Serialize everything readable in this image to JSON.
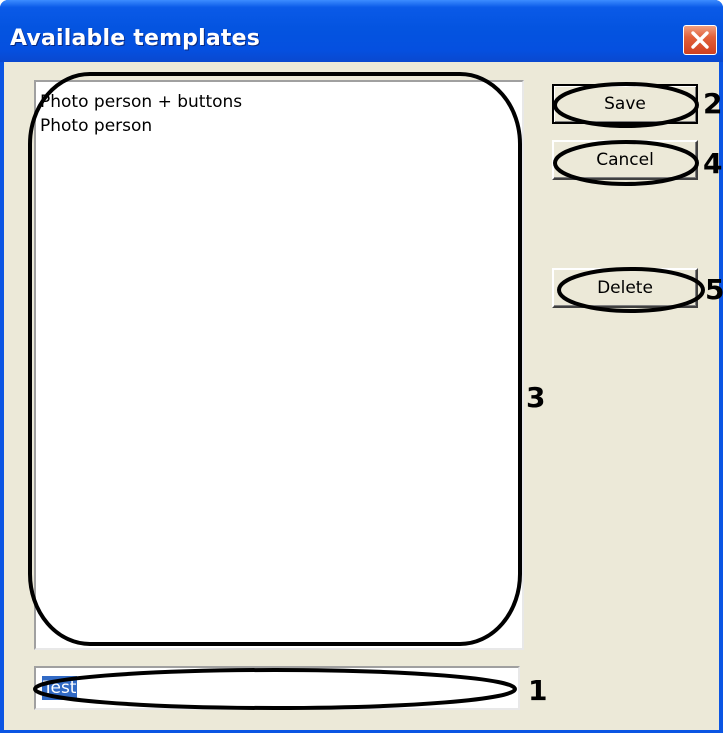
{
  "window": {
    "title": "Available templates"
  },
  "templates_list": {
    "items": [
      "Photo person + buttons",
      "Photo person"
    ]
  },
  "name_field": {
    "value": "Test"
  },
  "buttons": {
    "save_label": "Save",
    "cancel_label": "Cancel",
    "delete_label": "Delete"
  },
  "annotations": {
    "name_field": "1",
    "save": "2",
    "templates_list": "3",
    "cancel": "4",
    "delete": "5"
  },
  "colors": {
    "titlebar_blue": "#0454e0",
    "dialog_bg": "#ece9d8",
    "close_red": "#e2603a",
    "selection_blue": "#316ac5"
  },
  "icons": {
    "close": "close-icon"
  }
}
